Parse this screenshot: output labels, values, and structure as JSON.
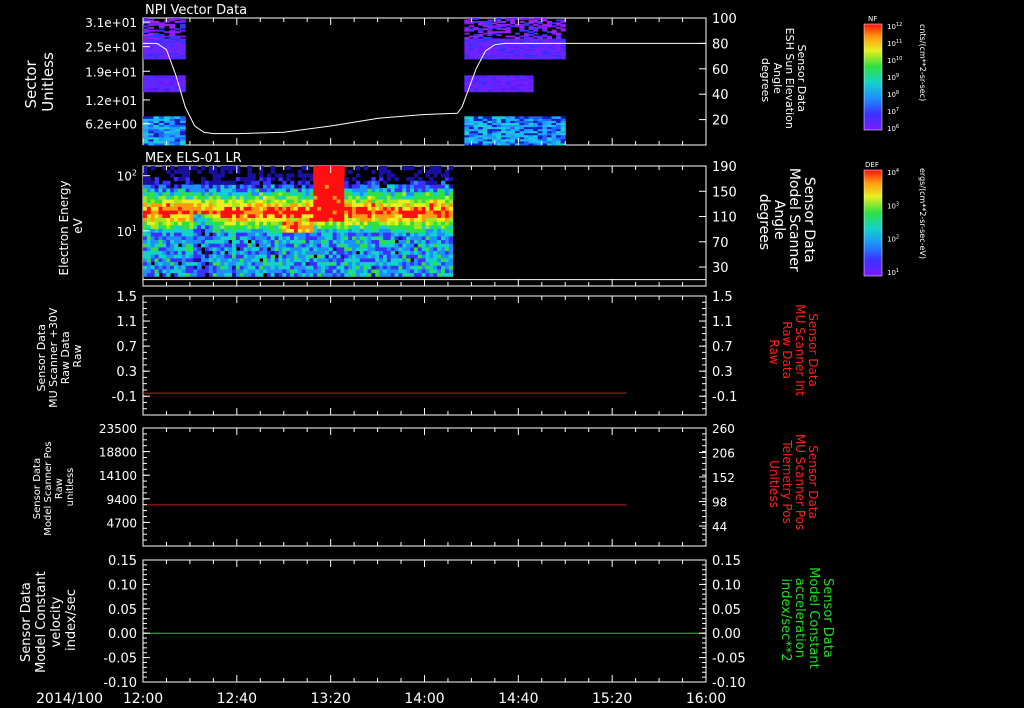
{
  "figure": {
    "date_label": "2014/100",
    "time_axis": {
      "ticks": [
        "12:00",
        "12:40",
        "13:20",
        "14:00",
        "14:40",
        "15:20",
        "16:00"
      ],
      "range_minutes": [
        0,
        240
      ]
    }
  },
  "colors": {
    "background": "#000000",
    "frame": "#ffffff",
    "red_line": "#cc1b1b",
    "green_line": "#22cc22",
    "white_line": "#ffffff",
    "right_label_red": "#ff2020",
    "right_label_green": "#22dd22"
  },
  "panels": [
    {
      "id": "npi",
      "title": "NPI Vector Data",
      "left_label": [
        "Sector",
        "Unitless"
      ],
      "left_ticks": [
        "3.1e+01",
        "2.5e+01",
        "1.9e+01",
        "1.2e+01",
        "6.2e+00"
      ],
      "right_label": [
        "Sensor Data",
        "ESH Sun Elevation",
        "Angle",
        "degrees"
      ],
      "right_ticks": [
        "100",
        "80",
        "60",
        "40",
        "20"
      ],
      "colorbar": {
        "label": "NF",
        "units": "cnts/(cm**2-sr-sec)",
        "ticks": [
          "10^12",
          "10^11",
          "10^10",
          "10^9",
          "10^8",
          "10^7",
          "10^6"
        ]
      }
    },
    {
      "id": "els",
      "title": "MEx ELS-01 LR",
      "left_label": [
        "Electron Energy",
        "eV"
      ],
      "left_ticks": [
        "10^2",
        "10^1"
      ],
      "right_label": [
        "Sensor Data",
        "Model Scanner",
        "Angle",
        "degrees"
      ],
      "right_ticks": [
        "190",
        "150",
        "110",
        "70",
        "30"
      ],
      "colorbar": {
        "label": "DEF",
        "units": "ergs/(cm**2-sr-sec-eV)",
        "ticks": [
          "10^4",
          "10^3",
          "10^2",
          "10^1"
        ]
      }
    },
    {
      "id": "mu_raw",
      "left_label": [
        "Sensor Data",
        "MU Scanner +30V",
        "Raw Data",
        "Raw"
      ],
      "left_ticks": [
        "1.5",
        "1.1",
        "0.7",
        "0.3",
        "-0.1"
      ],
      "right_label": [
        "Sensor Data",
        "MU Scanner Int",
        "Raw Data",
        "Raw"
      ],
      "right_ticks": [
        "1.5",
        "1.1",
        "0.7",
        "0.3",
        "-0.1"
      ]
    },
    {
      "id": "scanner_pos",
      "left_label": [
        "Sensor Data",
        "Model Scanner Pos",
        "Raw",
        "unitless"
      ],
      "left_ticks": [
        "23500",
        "18800",
        "14100",
        "9400",
        "4700"
      ],
      "right_label": [
        "Sensor Data",
        "MU Scanner Pos",
        "Telemetry Pos",
        "Unitless"
      ],
      "right_ticks": [
        "260",
        "206",
        "152",
        "98",
        "44"
      ]
    },
    {
      "id": "constant",
      "left_label": [
        "Sensor Data",
        "Model Constant",
        "velocity",
        "index/sec"
      ],
      "left_ticks": [
        "0.15",
        "0.10",
        "0.05",
        "0.00",
        "-0.05",
        "-0.10"
      ],
      "right_label": [
        "Sensor Data",
        "Model Constant",
        "acceleration",
        "index/sec**2"
      ],
      "right_ticks": [
        "0.15",
        "0.10",
        "0.05",
        "0.00",
        "-0.05",
        "-0.10"
      ]
    }
  ],
  "chart_data": [
    {
      "type": "heatmap",
      "title": "NPI Vector Data",
      "ylabel": "Sector Unitless",
      "y2label": "Sensor Data ESH Sun Elevation Angle degrees",
      "ylim": [
        1,
        32
      ],
      "y2lim": [
        0,
        100
      ],
      "time_bounds_minutes": [
        [
          0,
          18
        ],
        [
          137,
          180
        ]
      ],
      "overlay_line": {
        "name": "ESH Sun Elevation Angle",
        "x_minutes": [
          0,
          6,
          10,
          14,
          18,
          22,
          26,
          30,
          40,
          60,
          80,
          100,
          120,
          134,
          136,
          138,
          142,
          146,
          150,
          154,
          160,
          180,
          200,
          220,
          240
        ],
        "y_degrees": [
          80,
          80,
          75,
          55,
          30,
          15,
          10,
          9,
          9,
          10,
          15,
          21,
          24,
          25,
          30,
          40,
          60,
          74,
          79,
          80,
          80,
          80,
          80,
          80,
          80
        ]
      }
    },
    {
      "type": "heatmap",
      "title": "MEx ELS-01 LR",
      "ylabel": "Electron Energy eV",
      "y2label": "Sensor Data Model Scanner Angle degrees",
      "y_scale": "log",
      "ylim": [
        1,
        150
      ],
      "y2lim": [
        0,
        190
      ],
      "time_bounds_minutes": [
        0,
        132
      ],
      "overlay_line": {
        "name": "Model Scanner Angle",
        "x_minutes": [
          0,
          240
        ],
        "y_degrees": [
          10,
          10
        ]
      }
    },
    {
      "type": "line",
      "ylabel": "Sensor Data MU Scanner +30V Raw Data Raw",
      "y2label": "Sensor Data MU Scanner Int Raw Data Raw",
      "ylim": [
        -0.4,
        1.5
      ],
      "series": [
        {
          "x_minutes": [
            0,
            206
          ],
          "y": [
            -0.05,
            -0.05
          ]
        }
      ]
    },
    {
      "type": "line",
      "ylabel": "Sensor Data Model Scanner Pos Raw unitless",
      "y2label": "Sensor Data MU Scanner Pos Telemetry Pos Unitless",
      "ylim": [
        0,
        23500
      ],
      "series": [
        {
          "x_minutes": [
            0,
            206
          ],
          "y": [
            8200,
            8200
          ]
        }
      ]
    },
    {
      "type": "line",
      "ylabel": "Sensor Data Model Constant velocity index/sec",
      "y2label": "Sensor Data Model Constant acceleration index/sec**2",
      "ylim": [
        -0.1,
        0.15
      ],
      "series": [
        {
          "x_minutes": [
            0,
            240
          ],
          "y": [
            0.0,
            0.0
          ]
        }
      ]
    }
  ]
}
